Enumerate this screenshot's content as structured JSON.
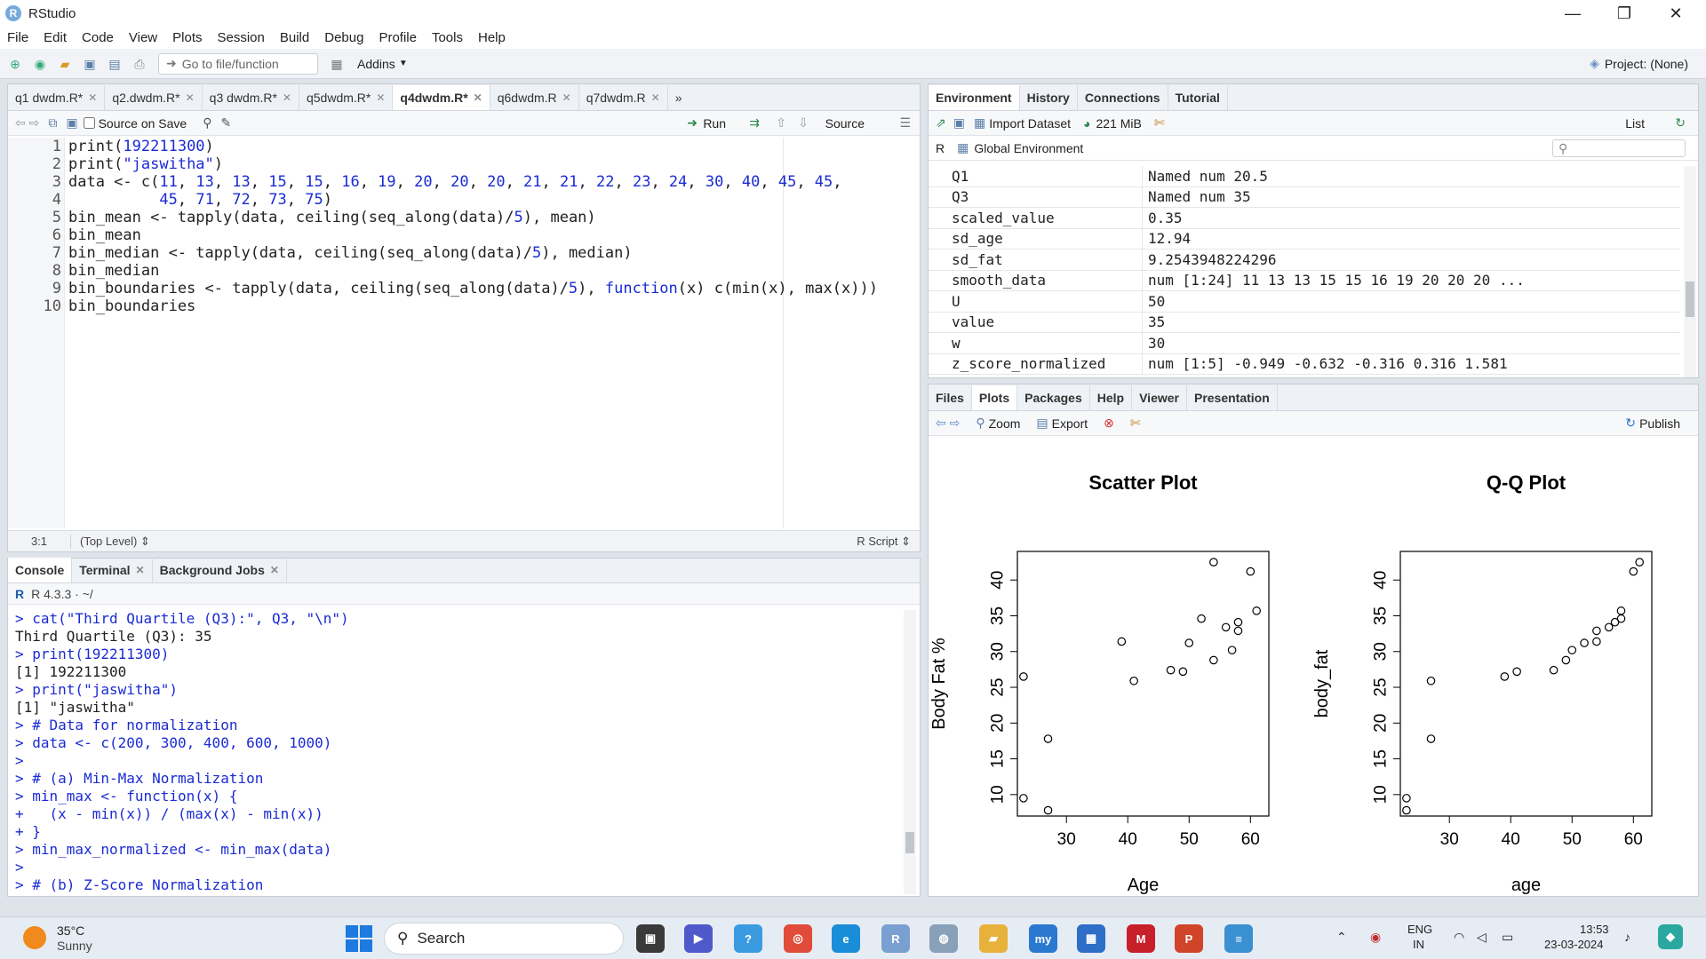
{
  "window": {
    "title": "RStudio",
    "minimize": "—",
    "restore": "❐",
    "close": "✕"
  },
  "menu": [
    "File",
    "Edit",
    "Code",
    "View",
    "Plots",
    "Session",
    "Build",
    "Debug",
    "Profile",
    "Tools",
    "Help"
  ],
  "toolbar": {
    "goto_placeholder": "Go to file/function",
    "addins": "Addins",
    "project": "Project: (None)"
  },
  "editor": {
    "tabs": [
      "q1 dwdm.R*",
      "q2.dwdm.R*",
      "q3 dwdm.R*",
      "q5dwdm.R*",
      "q4dwdm.R*",
      "q6dwdm.R",
      "q7dwdm.R"
    ],
    "active_tab": "q4dwdm.R*",
    "source_on_save": "Source on Save",
    "run": "Run",
    "source": "Source",
    "line_numbers": [
      "1",
      "2",
      "3",
      "4",
      "5",
      "6",
      "7",
      "8",
      "9",
      "10"
    ],
    "status_pos": "3:1",
    "status_level": "(Top Level) ⇕",
    "status_type": "R Script ⇕"
  },
  "console": {
    "tabs": [
      "Console",
      "Terminal",
      "Background Jobs"
    ],
    "version": "R 4.3.3 · ~/",
    "lines": [
      {
        "t": "> cat(\"Third Quartile (Q3):\", Q3, \"\\n\")",
        "c": "blue"
      },
      {
        "t": "Third Quartile (Q3): 35",
        "c": ""
      },
      {
        "t": "> print(192211300)",
        "c": "blue"
      },
      {
        "t": "[1] 192211300",
        "c": ""
      },
      {
        "t": "> print(\"jaswitha\")",
        "c": "blue"
      },
      {
        "t": "[1] \"jaswitha\"",
        "c": ""
      },
      {
        "t": "> # Data for normalization",
        "c": "blue"
      },
      {
        "t": "> data <- c(200, 300, 400, 600, 1000)",
        "c": "blue"
      },
      {
        "t": ">",
        "c": "blue"
      },
      {
        "t": "> # (a) Min-Max Normalization",
        "c": "blue"
      },
      {
        "t": "> min_max <- function(x) {",
        "c": "blue"
      },
      {
        "t": "+   (x - min(x)) / (max(x) - min(x))",
        "c": "blue"
      },
      {
        "t": "+ }",
        "c": "blue"
      },
      {
        "t": "> min_max_normalized <- min_max(data)",
        "c": "blue"
      },
      {
        "t": ">",
        "c": "blue"
      },
      {
        "t": "> # (b) Z-Score Normalization",
        "c": "blue"
      }
    ]
  },
  "environment": {
    "tabs": [
      "Environment",
      "History",
      "Connections",
      "Tutorial"
    ],
    "import": "Import Dataset",
    "memory": "221 MiB",
    "list": "List",
    "lang": "R",
    "scope": "Global Environment",
    "rows": [
      {
        "name": "Q1",
        "value": "Named num 20.5"
      },
      {
        "name": "Q3",
        "value": "Named num 35"
      },
      {
        "name": "scaled_value",
        "value": "0.35"
      },
      {
        "name": "sd_age",
        "value": "12.94"
      },
      {
        "name": "sd_fat",
        "value": "9.2543948224296"
      },
      {
        "name": "smooth_data",
        "value": "num [1:24] 11 13 13 15 15 16 19 20 20 20 ..."
      },
      {
        "name": "U",
        "value": "50"
      },
      {
        "name": "value",
        "value": "35"
      },
      {
        "name": "w",
        "value": "30"
      },
      {
        "name": "z_score_normalized",
        "value": "num [1:5] -0.949 -0.632 -0.316 0.316 1.581"
      }
    ]
  },
  "files": {
    "tabs": [
      "Files",
      "Plots",
      "Packages",
      "Help",
      "Viewer",
      "Presentation"
    ],
    "zoom": "Zoom",
    "export": "Export",
    "publish": "Publish"
  },
  "chart_data": [
    {
      "type": "scatter",
      "title": "Scatter Plot",
      "xlabel": "Age",
      "ylabel": "Body Fat %",
      "xlim": [
        22,
        63
      ],
      "ylim": [
        7,
        44
      ],
      "xticks": [
        "30",
        "40",
        "50",
        "60"
      ],
      "yticks": [
        "10",
        "15",
        "20",
        "25",
        "30",
        "35",
        "40"
      ],
      "points": [
        [
          23,
          9.5
        ],
        [
          23,
          26.5
        ],
        [
          27,
          7.8
        ],
        [
          27,
          17.8
        ],
        [
          39,
          31.4
        ],
        [
          41,
          25.9
        ],
        [
          47,
          27.4
        ],
        [
          49,
          27.2
        ],
        [
          50,
          31.2
        ],
        [
          52,
          34.6
        ],
        [
          54,
          42.5
        ],
        [
          54,
          28.8
        ],
        [
          56,
          33.4
        ],
        [
          57,
          30.2
        ],
        [
          58,
          34.1
        ],
        [
          58,
          32.9
        ],
        [
          60,
          41.2
        ],
        [
          61,
          35.7
        ]
      ]
    },
    {
      "type": "scatter",
      "title": "Q-Q Plot",
      "xlabel": "age",
      "ylabel": "body_fat",
      "xlim": [
        22,
        63
      ],
      "ylim": [
        7,
        44
      ],
      "xticks": [
        "30",
        "40",
        "50",
        "60"
      ],
      "yticks": [
        "10",
        "15",
        "20",
        "25",
        "30",
        "35",
        "40"
      ],
      "points": [
        [
          23,
          7.8
        ],
        [
          23,
          9.5
        ],
        [
          27,
          17.8
        ],
        [
          27,
          25.9
        ],
        [
          39,
          26.5
        ],
        [
          41,
          27.2
        ],
        [
          47,
          27.4
        ],
        [
          49,
          28.8
        ],
        [
          50,
          30.2
        ],
        [
          52,
          31.2
        ],
        [
          54,
          31.4
        ],
        [
          54,
          32.9
        ],
        [
          56,
          33.4
        ],
        [
          57,
          34.1
        ],
        [
          58,
          34.6
        ],
        [
          58,
          35.7
        ],
        [
          60,
          41.2
        ],
        [
          61,
          42.5
        ]
      ]
    }
  ],
  "taskbar": {
    "temp": "35°C",
    "weather": "Sunny",
    "search": "Search",
    "lang1": "ENG",
    "lang2": "IN",
    "time": "13:53",
    "date": "23-03-2024"
  }
}
